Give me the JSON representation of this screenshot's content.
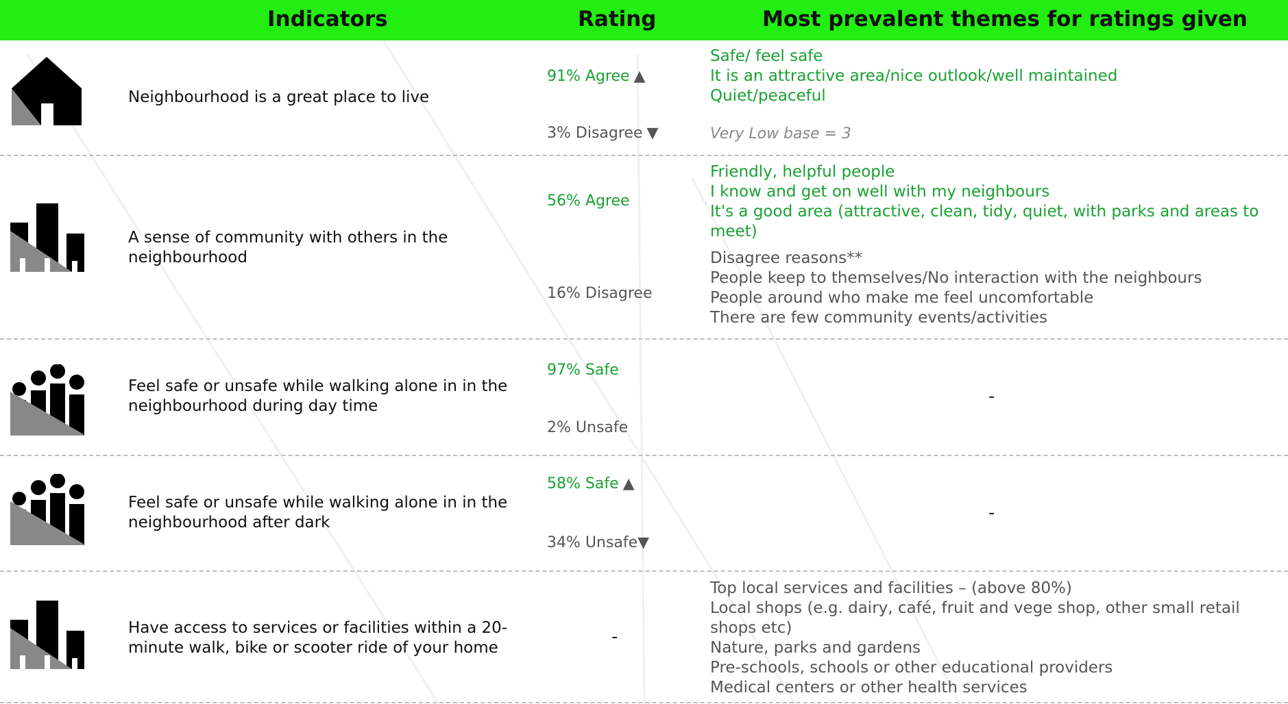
{
  "header": {
    "indicators": "Indicators",
    "rating": "Rating",
    "themes": "Most prevalent themes for ratings given"
  },
  "colors": {
    "header_bg": "#22ee11",
    "positive_text": "#1aa033",
    "neutral_text": "#555555"
  },
  "rows": [
    {
      "icon": "house-icon",
      "indicator": "Neighbourhood is a great place to live",
      "rating_positive": "91% Agree",
      "rating_positive_trend": "up",
      "rating_negative": "3% Disagree",
      "rating_negative_trend": "down",
      "themes_positive": [
        "Safe/ feel safe",
        "It is an attractive area/nice outlook/well maintained",
        "Quiet/peaceful"
      ],
      "themes_note": "Very Low base = 3"
    },
    {
      "icon": "buildings-icon",
      "indicator": "A sense of community with others in the neighbourhood",
      "rating_positive": "56% Agree",
      "rating_negative": "16% Disagree",
      "themes_positive": [
        "Friendly, helpful people",
        "I know and get on well with my neighbours",
        "It's a good area (attractive, clean, tidy, quiet, with parks and areas to meet)"
      ],
      "themes_negative_title": "Disagree reasons**",
      "themes_negative": [
        "People keep to themselves/No interaction with the neighbours",
        "People around who make me feel uncomfortable",
        "There are few community events/activities"
      ]
    },
    {
      "icon": "people-icon",
      "indicator": "Feel safe or unsafe while walking alone in in the neighbourhood during day time",
      "rating_positive": "97% Safe",
      "rating_negative": "2% Unsafe",
      "themes_dash": "-"
    },
    {
      "icon": "people-icon",
      "indicator": "Feel safe or unsafe while walking alone in in the neighbourhood after dark",
      "rating_positive": "58% Safe",
      "rating_positive_trend": "up",
      "rating_negative": "34% Unsafe",
      "rating_negative_trend": "down",
      "themes_dash": "-"
    },
    {
      "icon": "buildings-icon",
      "indicator": "Have access to services or facilities within a 20-minute walk, bike or scooter ride of your home",
      "rating_dash": "-",
      "themes_list": [
        "Top local services and facilities – (above 80%)",
        "Local shops (e.g. dairy, café, fruit and vege shop, other small retail shops etc)",
        "Nature, parks and gardens",
        "Pre-schools, schools or other educational providers",
        "Medical centers or other health services"
      ]
    }
  ],
  "trend_symbols": {
    "up": "▲",
    "down": "▼"
  }
}
